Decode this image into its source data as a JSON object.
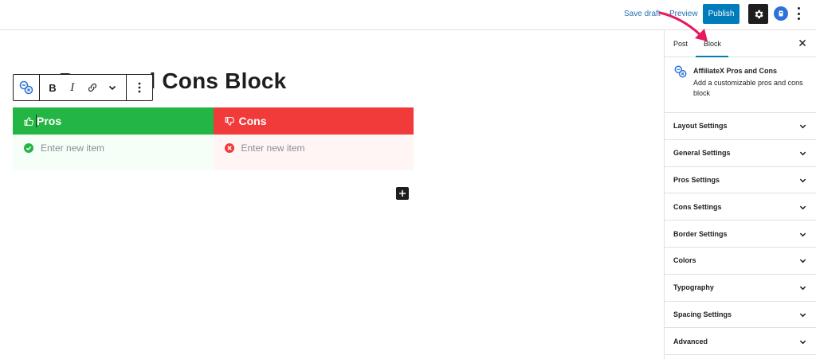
{
  "topbar": {
    "save_draft": "Save draft",
    "preview": "Preview",
    "publish": "Publish",
    "settings_icon": "gear-icon",
    "plugin_icon": "plugin-logo-icon",
    "more_icon": "kebab-vertical-icon"
  },
  "editor": {
    "title": "Pros and Cons Block",
    "toolbar": {
      "bold": "B",
      "italic": "I"
    },
    "pros": {
      "heading": "Pros",
      "placeholder": "Enter new item",
      "color": "#24b644"
    },
    "cons": {
      "heading": "Cons",
      "placeholder": "Enter new item",
      "color": "#f13a3a"
    }
  },
  "sidebar": {
    "tabs": [
      "Post",
      "Block"
    ],
    "active_tab": "Block",
    "block_card": {
      "title": "AffiliateX Pros and Cons",
      "description": "Add a customizable pros and cons block"
    },
    "panels": [
      "Layout Settings",
      "General Settings",
      "Pros Settings",
      "Cons Settings",
      "Border Settings",
      "Colors",
      "Typography",
      "Spacing Settings",
      "Advanced"
    ]
  },
  "colors": {
    "accent": "#007cba",
    "annotation_arrow": "#e8185f"
  }
}
